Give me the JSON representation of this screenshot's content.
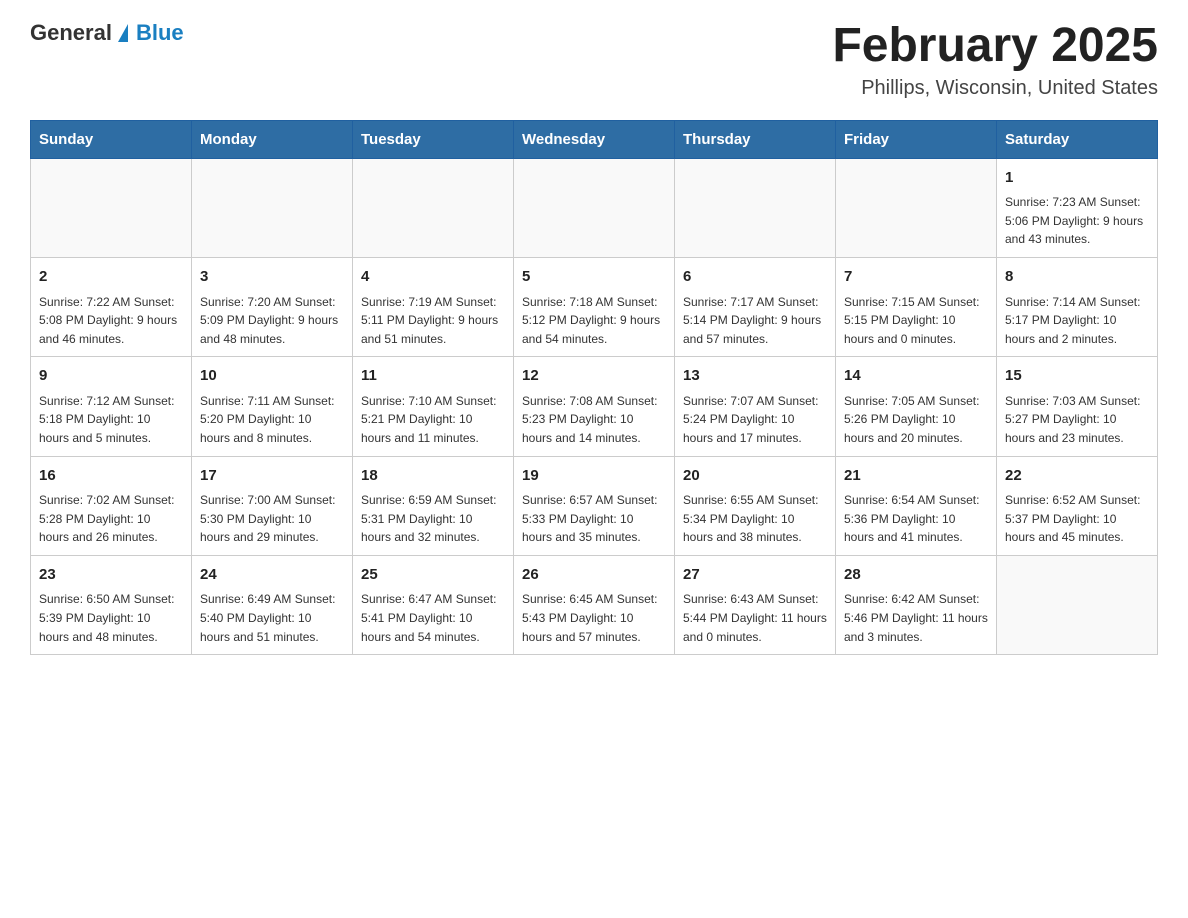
{
  "header": {
    "logo": {
      "general": "General",
      "blue": "Blue"
    },
    "title": "February 2025",
    "subtitle": "Phillips, Wisconsin, United States"
  },
  "weekdays": [
    "Sunday",
    "Monday",
    "Tuesday",
    "Wednesday",
    "Thursday",
    "Friday",
    "Saturday"
  ],
  "weeks": [
    [
      {
        "day": "",
        "info": ""
      },
      {
        "day": "",
        "info": ""
      },
      {
        "day": "",
        "info": ""
      },
      {
        "day": "",
        "info": ""
      },
      {
        "day": "",
        "info": ""
      },
      {
        "day": "",
        "info": ""
      },
      {
        "day": "1",
        "info": "Sunrise: 7:23 AM\nSunset: 5:06 PM\nDaylight: 9 hours and 43 minutes."
      }
    ],
    [
      {
        "day": "2",
        "info": "Sunrise: 7:22 AM\nSunset: 5:08 PM\nDaylight: 9 hours and 46 minutes."
      },
      {
        "day": "3",
        "info": "Sunrise: 7:20 AM\nSunset: 5:09 PM\nDaylight: 9 hours and 48 minutes."
      },
      {
        "day": "4",
        "info": "Sunrise: 7:19 AM\nSunset: 5:11 PM\nDaylight: 9 hours and 51 minutes."
      },
      {
        "day": "5",
        "info": "Sunrise: 7:18 AM\nSunset: 5:12 PM\nDaylight: 9 hours and 54 minutes."
      },
      {
        "day": "6",
        "info": "Sunrise: 7:17 AM\nSunset: 5:14 PM\nDaylight: 9 hours and 57 minutes."
      },
      {
        "day": "7",
        "info": "Sunrise: 7:15 AM\nSunset: 5:15 PM\nDaylight: 10 hours and 0 minutes."
      },
      {
        "day": "8",
        "info": "Sunrise: 7:14 AM\nSunset: 5:17 PM\nDaylight: 10 hours and 2 minutes."
      }
    ],
    [
      {
        "day": "9",
        "info": "Sunrise: 7:12 AM\nSunset: 5:18 PM\nDaylight: 10 hours and 5 minutes."
      },
      {
        "day": "10",
        "info": "Sunrise: 7:11 AM\nSunset: 5:20 PM\nDaylight: 10 hours and 8 minutes."
      },
      {
        "day": "11",
        "info": "Sunrise: 7:10 AM\nSunset: 5:21 PM\nDaylight: 10 hours and 11 minutes."
      },
      {
        "day": "12",
        "info": "Sunrise: 7:08 AM\nSunset: 5:23 PM\nDaylight: 10 hours and 14 minutes."
      },
      {
        "day": "13",
        "info": "Sunrise: 7:07 AM\nSunset: 5:24 PM\nDaylight: 10 hours and 17 minutes."
      },
      {
        "day": "14",
        "info": "Sunrise: 7:05 AM\nSunset: 5:26 PM\nDaylight: 10 hours and 20 minutes."
      },
      {
        "day": "15",
        "info": "Sunrise: 7:03 AM\nSunset: 5:27 PM\nDaylight: 10 hours and 23 minutes."
      }
    ],
    [
      {
        "day": "16",
        "info": "Sunrise: 7:02 AM\nSunset: 5:28 PM\nDaylight: 10 hours and 26 minutes."
      },
      {
        "day": "17",
        "info": "Sunrise: 7:00 AM\nSunset: 5:30 PM\nDaylight: 10 hours and 29 minutes."
      },
      {
        "day": "18",
        "info": "Sunrise: 6:59 AM\nSunset: 5:31 PM\nDaylight: 10 hours and 32 minutes."
      },
      {
        "day": "19",
        "info": "Sunrise: 6:57 AM\nSunset: 5:33 PM\nDaylight: 10 hours and 35 minutes."
      },
      {
        "day": "20",
        "info": "Sunrise: 6:55 AM\nSunset: 5:34 PM\nDaylight: 10 hours and 38 minutes."
      },
      {
        "day": "21",
        "info": "Sunrise: 6:54 AM\nSunset: 5:36 PM\nDaylight: 10 hours and 41 minutes."
      },
      {
        "day": "22",
        "info": "Sunrise: 6:52 AM\nSunset: 5:37 PM\nDaylight: 10 hours and 45 minutes."
      }
    ],
    [
      {
        "day": "23",
        "info": "Sunrise: 6:50 AM\nSunset: 5:39 PM\nDaylight: 10 hours and 48 minutes."
      },
      {
        "day": "24",
        "info": "Sunrise: 6:49 AM\nSunset: 5:40 PM\nDaylight: 10 hours and 51 minutes."
      },
      {
        "day": "25",
        "info": "Sunrise: 6:47 AM\nSunset: 5:41 PM\nDaylight: 10 hours and 54 minutes."
      },
      {
        "day": "26",
        "info": "Sunrise: 6:45 AM\nSunset: 5:43 PM\nDaylight: 10 hours and 57 minutes."
      },
      {
        "day": "27",
        "info": "Sunrise: 6:43 AM\nSunset: 5:44 PM\nDaylight: 11 hours and 0 minutes."
      },
      {
        "day": "28",
        "info": "Sunrise: 6:42 AM\nSunset: 5:46 PM\nDaylight: 11 hours and 3 minutes."
      },
      {
        "day": "",
        "info": ""
      }
    ]
  ]
}
